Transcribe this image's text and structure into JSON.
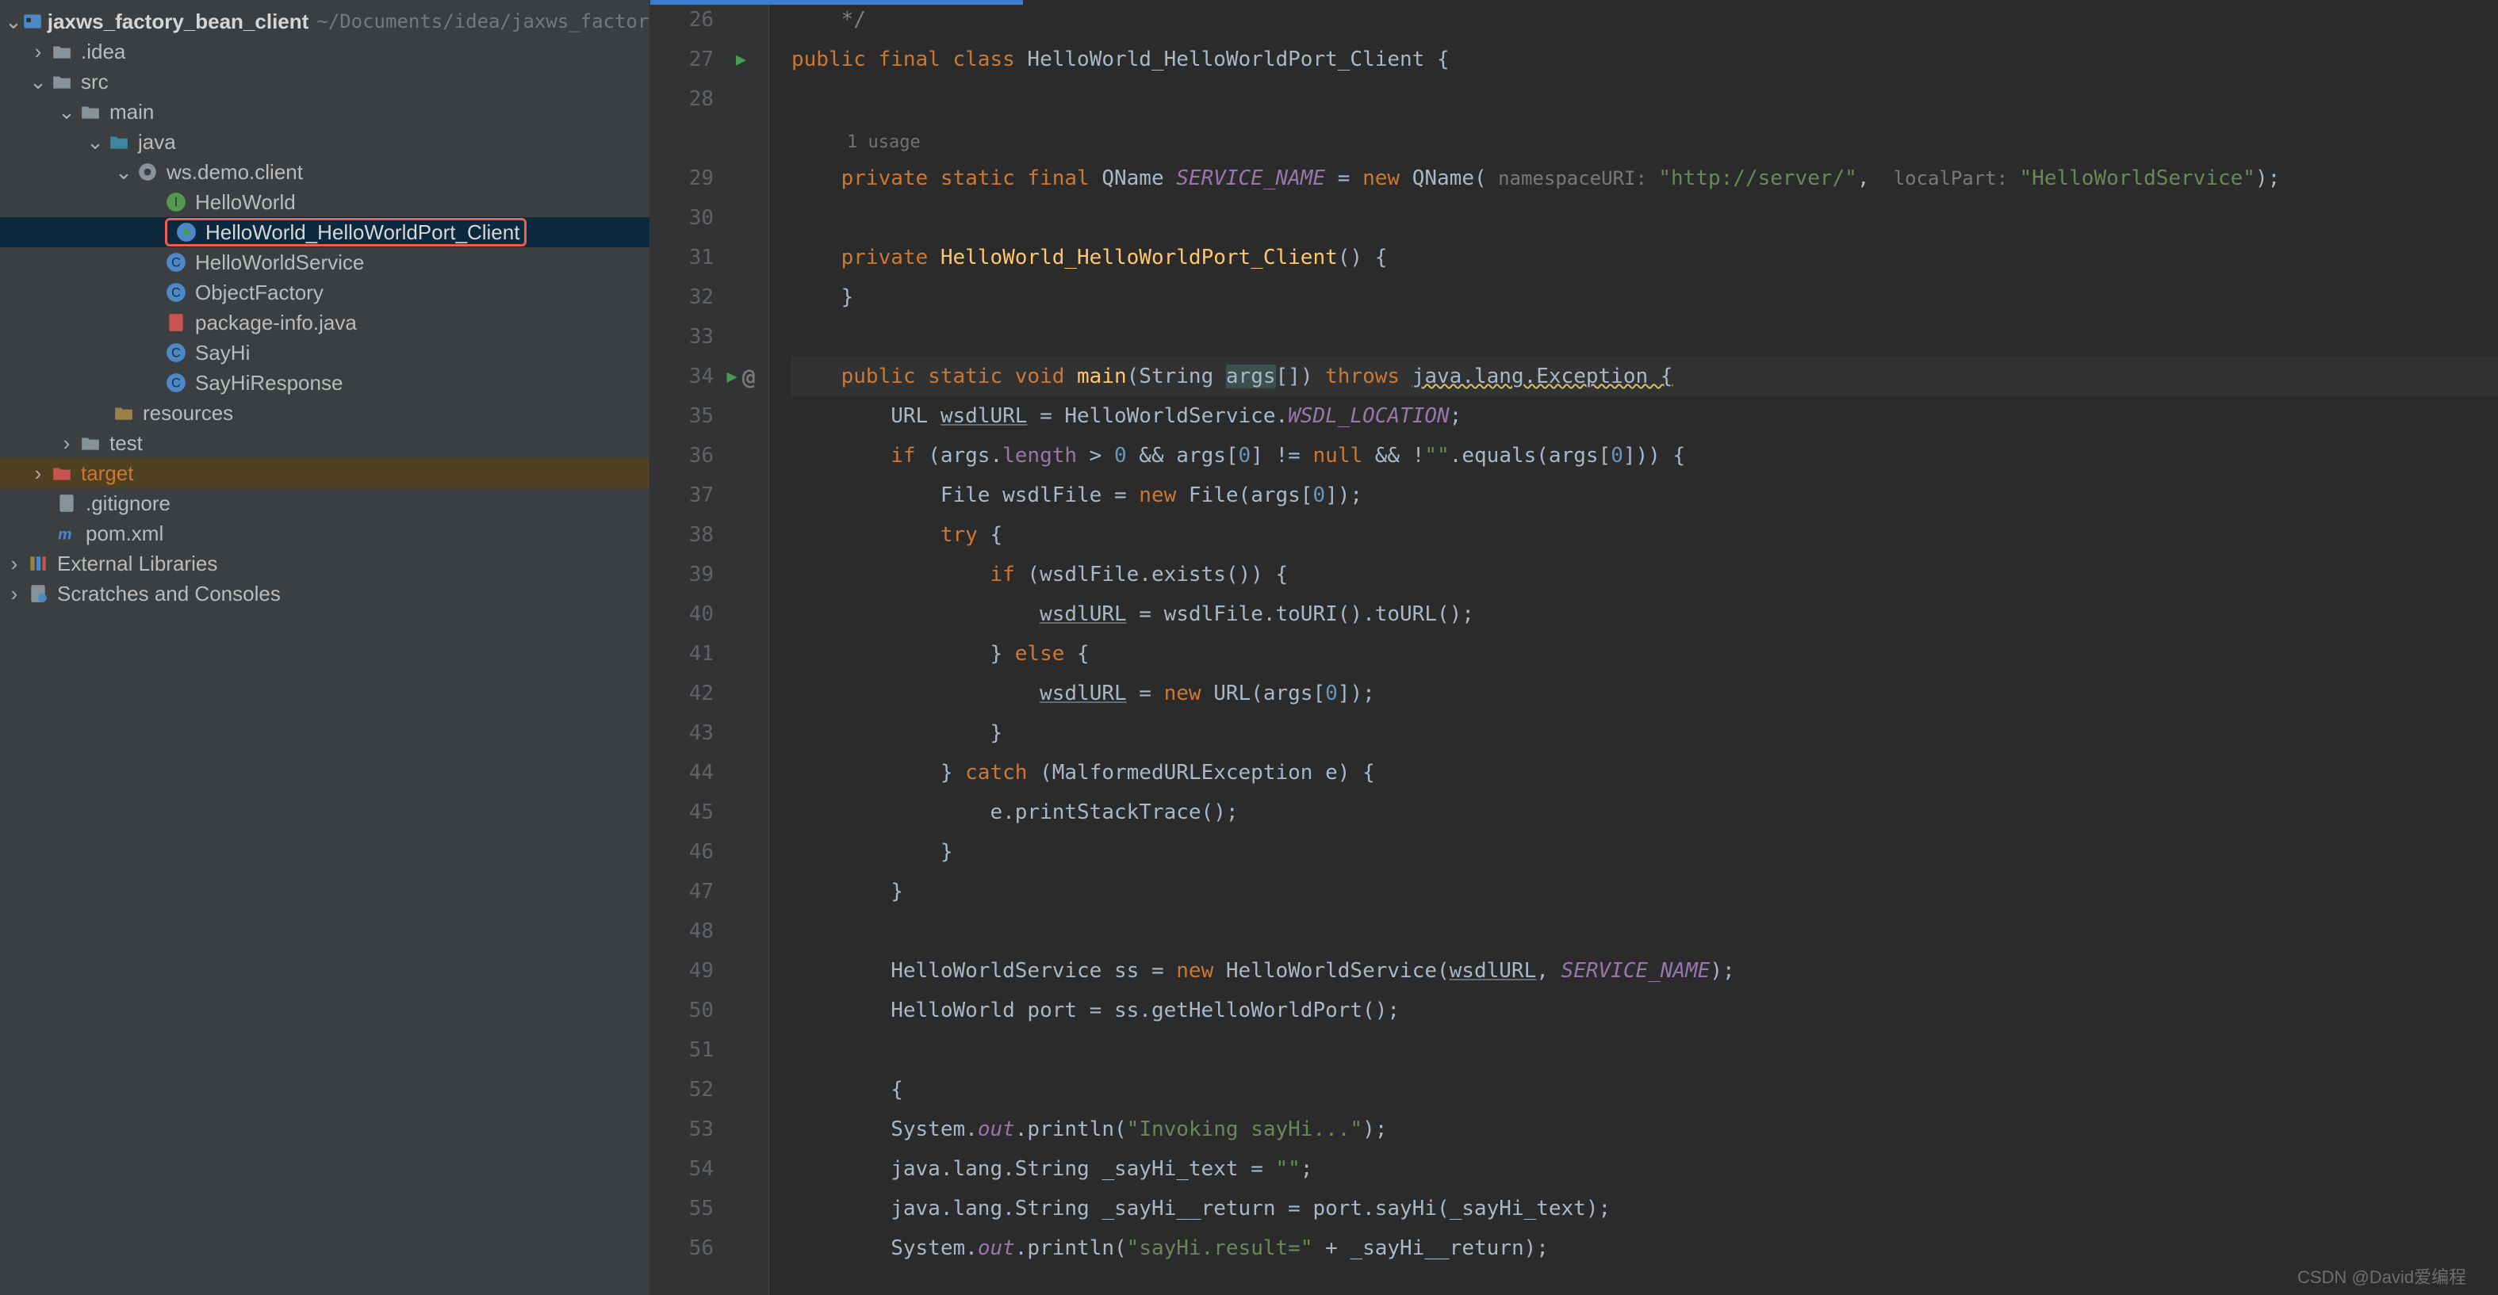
{
  "project": {
    "name": "jaxws_factory_bean_client",
    "path": "~/Documents/idea/jaxws_factory..."
  },
  "tree": {
    "idea": ".idea",
    "src": "src",
    "main": "main",
    "java": "java",
    "pkg": "ws.demo.client",
    "files": {
      "f1": "HelloWorld",
      "f2": "HelloWorld_HelloWorldPort_Client",
      "f3": "HelloWorldService",
      "f4": "ObjectFactory",
      "f5": "package-info.java",
      "f6": "SayHi",
      "f7": "SayHiResponse"
    },
    "resources": "resources",
    "test": "test",
    "target": "target",
    "gitignore": ".gitignore",
    "pom": "pom.xml",
    "ext": "External Libraries",
    "scratches": "Scratches and Consoles"
  },
  "gutter": {
    "lines": [
      26,
      27,
      28,
      "",
      29,
      30,
      31,
      32,
      33,
      34,
      35,
      36,
      37,
      38,
      39,
      40,
      41,
      42,
      43,
      44,
      45,
      46,
      47,
      48,
      49,
      50,
      51,
      52,
      53,
      54,
      55,
      56
    ]
  },
  "usage": "1 usage",
  "code": {
    "l26": "    */",
    "l27a": "public final class ",
    "l27b": "HelloWorld_HelloWorldPort_Client {",
    "l29a": "    private static final ",
    "l29b": "QName ",
    "l29c": "SERVICE_NAME",
    "l29d": " = ",
    "l29e": "new ",
    "l29f": "QName(",
    "l29h1": " namespaceURI: ",
    "l29s1": "\"http://server/\"",
    "l29g": ", ",
    "l29h2": " localPart: ",
    "l29s2": "\"HelloWorldService\"",
    "l29end": ");",
    "l31a": "    private ",
    "l31b": "HelloWorld_HelloWorldPort_Client",
    "l31c": "() {",
    "l32": "    }",
    "l34a": "    public static void ",
    "l34b": "main",
    "l34c": "(String ",
    "l34d": "args",
    "l34e": "[]) ",
    "l34f": "throws ",
    "l34g": "java.lang.Exception {",
    "l35a": "        URL ",
    "l35b": "wsdlURL",
    "l35c": " = HelloWorldService.",
    "l35d": "WSDL_LOCATION",
    "l35e": ";",
    "l36a": "        if ",
    "l36b": "(args.",
    "l36c": "length",
    "l36d": " > ",
    "l36n0": "0",
    "l36e": " && args[",
    "l36n1": "0",
    "l36f": "] != ",
    "l36g": "null ",
    "l36h": "&& !",
    "l36s": "\"\"",
    "l36i": ".equals(args[",
    "l36n2": "0",
    "l36j": "])) {",
    "l37a": "            File wsdlFile = ",
    "l37b": "new ",
    "l37c": "File(args[",
    "l37n": "0",
    "l37d": "]);",
    "l38a": "            try ",
    "l38b": "{",
    "l39a": "                if ",
    "l39b": "(wsdlFile.exists()) {",
    "l40a": "                    ",
    "l40b": "wsdlURL",
    "l40c": " = wsdlFile.toURI().toURL();",
    "l41a": "                } ",
    "l41b": "else ",
    "l41c": "{",
    "l42a": "                    ",
    "l42b": "wsdlURL",
    "l42c": " = ",
    "l42d": "new ",
    "l42e": "URL(args[",
    "l42n": "0",
    "l42f": "]);",
    "l43": "                }",
    "l44a": "            } ",
    "l44b": "catch ",
    "l44c": "(MalformedURLException e) {",
    "l45": "                e.printStackTrace();",
    "l46": "            }",
    "l47": "        }",
    "l49a": "        HelloWorldService ss = ",
    "l49b": "new ",
    "l49c": "HelloWorldService(",
    "l49d": "wsdlURL",
    "l49e": ", ",
    "l49f": "SERVICE_NAME",
    "l49g": ");",
    "l50": "        HelloWorld port = ss.getHelloWorldPort();",
    "l52": "        {",
    "l53a": "        System.",
    "l53b": "out",
    "l53c": ".println(",
    "l53s": "\"Invoking sayHi...\"",
    "l53d": ");",
    "l54a": "        java.lang.String _sayHi_text = ",
    "l54s": "\"\"",
    "l54b": ";",
    "l55": "        java.lang.String _sayHi__return = port.sayHi(_sayHi_text);",
    "l56a": "        System.",
    "l56b": "out",
    "l56c": ".println(",
    "l56s": "\"sayHi.result=\"",
    "l56d": " + _sayHi__return);"
  },
  "watermark": "CSDN @David爱编程"
}
